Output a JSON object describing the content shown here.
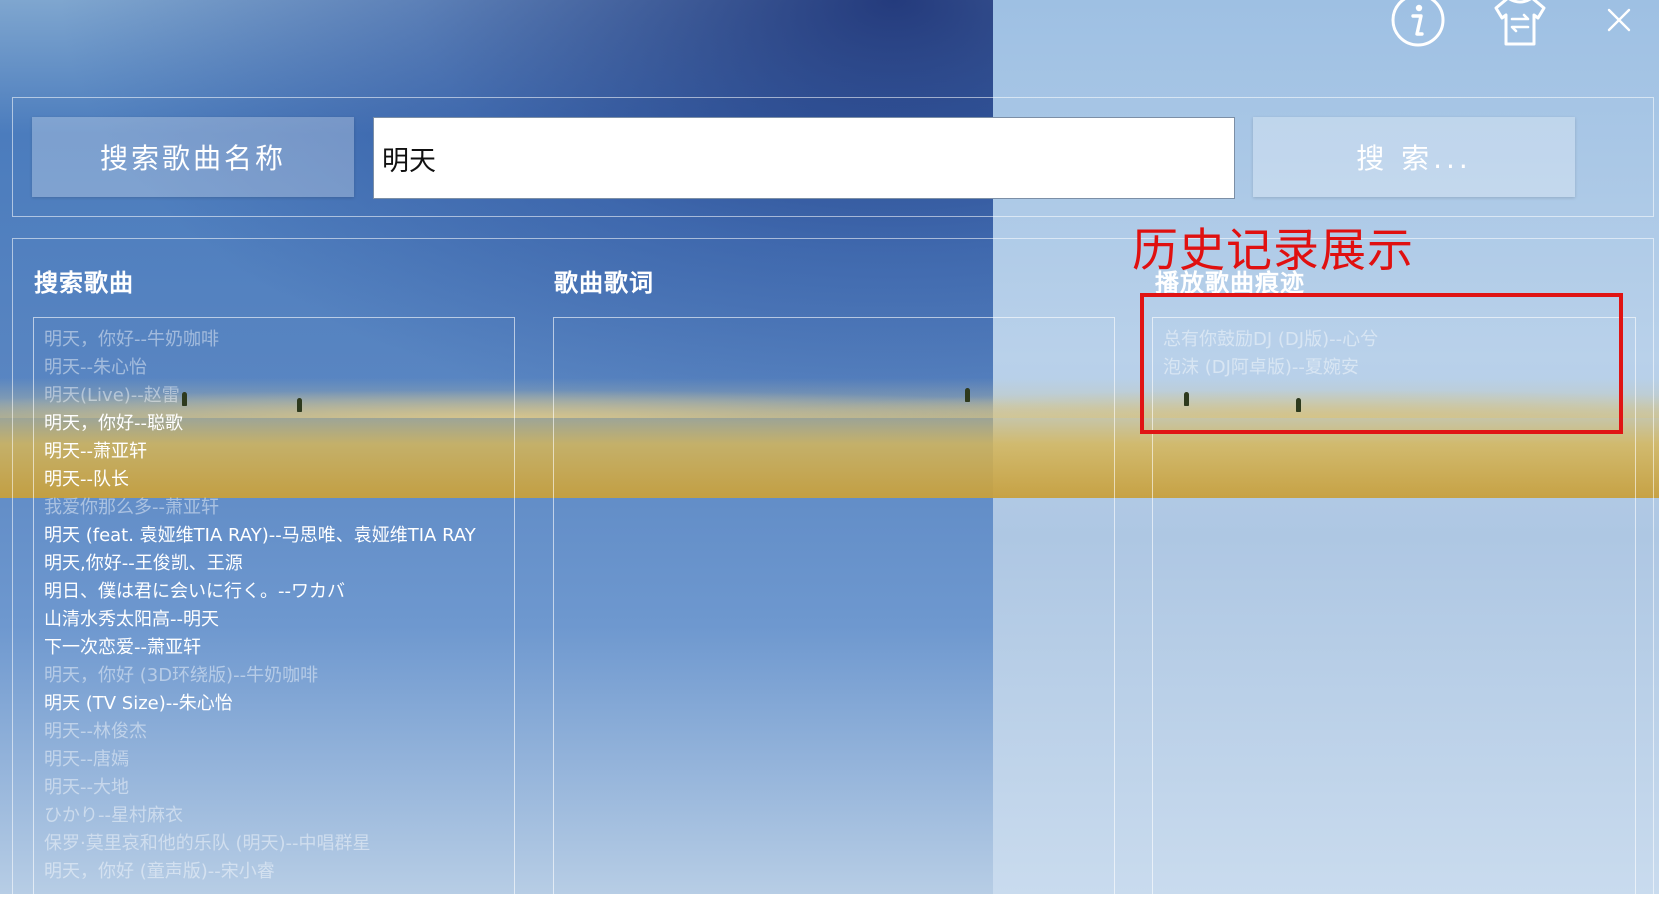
{
  "header": {
    "icons": [
      "info-icon",
      "skin-change-icon",
      "close-icon"
    ]
  },
  "search": {
    "label_button": "搜索歌曲名称",
    "input_value": "明天",
    "search_button": "搜 索..."
  },
  "sections": {
    "search_results_title": "搜索歌曲",
    "lyrics_title": "歌曲歌词",
    "history_title": "播放歌曲痕迹"
  },
  "search_results": [
    "明天，你好--牛奶咖啡",
    "明天--朱心怡",
    "明天(Live)--赵雷",
    "明天，你好--聪歌",
    "明天--萧亚轩",
    "明天--队长",
    "我爱你那么多--萧亚轩",
    "明天 (feat. 袁娅维TIA RAY)--马思唯、袁娅维TIA RAY",
    "明天,你好--王俊凯、王源",
    "明日、僕は君に会いに行く。--ワカバ",
    "山清水秀太阳高--明天",
    "下一次恋爱--萧亚轩",
    "明天，你好 (3D环绕版)--牛奶咖啡",
    "明天 (TV Size)--朱心怡",
    "明天--林俊杰",
    "明天--唐嫣",
    "明天--大地",
    "ひかり--星村麻衣",
    "保罗·莫里哀和他的乐队 (明天)--中唱群星",
    "明天，你好 (童声版)--宋小睿"
  ],
  "history": [
    "总有你鼓励DJ (DJ版)--心兮",
    "泡沫 (DJ阿卓版)--夏婉安"
  ],
  "annotation": {
    "text": "历史记录展示",
    "color": "#e01010"
  }
}
